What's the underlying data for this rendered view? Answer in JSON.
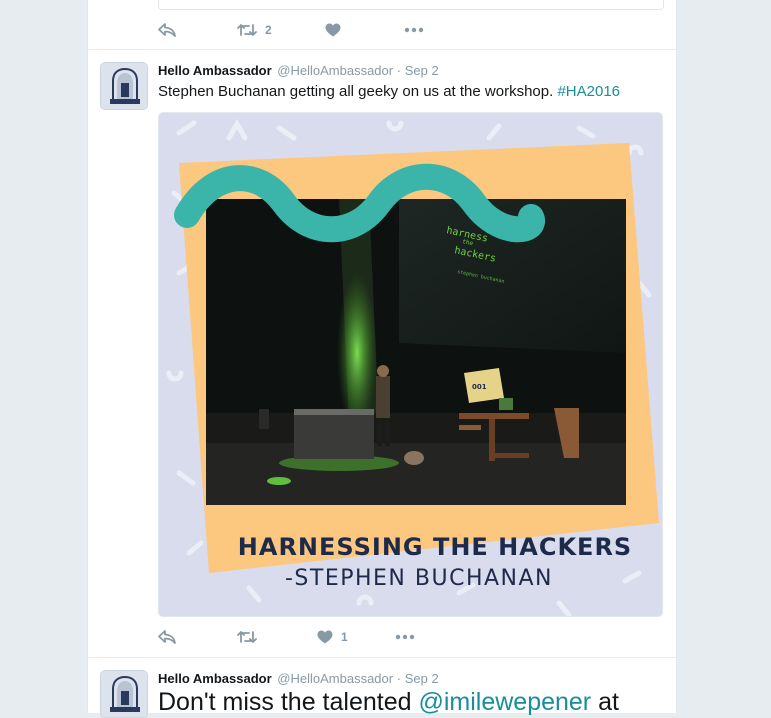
{
  "top_tweet": {
    "retweet_count": "2"
  },
  "tweet1": {
    "name": "Hello Ambassador",
    "handle": "@HelloAmbassador",
    "separator": "·",
    "date": "Sep 2",
    "text": "Stephen Buchanan getting all geeky on us at the workshop. ",
    "hashtag": "#HA2016",
    "image": {
      "screen_title": "harness the hackers",
      "screen_title_line1": "harness",
      "screen_title_line2": "the",
      "screen_title_line3": "hackers",
      "screen_subtitle": "stephen buchanan",
      "caption_title": "HARNESSING THE HACKERS",
      "caption_subtitle": "-STEPHEN BUCHANAN",
      "sign_number": "001"
    },
    "like_count": "1"
  },
  "tweet2": {
    "name": "Hello Ambassador",
    "handle": "@HelloAmbassador",
    "separator": "·",
    "date": "Sep 2",
    "text": "Don't miss the talented ",
    "mention": "@imilewepener",
    "text_after": " at"
  },
  "colors": {
    "link": "#1a8d9a",
    "icon": "#8899a6",
    "wave": "#3bb5a9",
    "orange": "#fcc77f",
    "navy": "#1e2a4a"
  },
  "icons": [
    "reply-icon",
    "retweet-icon",
    "like-icon",
    "more-icon"
  ]
}
